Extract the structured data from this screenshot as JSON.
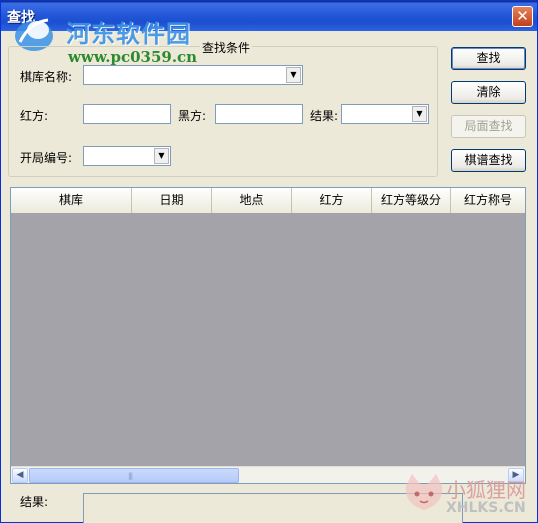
{
  "window": {
    "title": "查找",
    "close_glyph": "✕"
  },
  "watermark": {
    "brand": "河东软件园",
    "url": "www.pc0359.cn",
    "site2_cn": "小狐狸网",
    "site2_en": "XHLKS.CN"
  },
  "search": {
    "group_title": "查找条件",
    "game_name_label": "棋库名称:",
    "red_label": "红方:",
    "black_label": "黑方:",
    "result_label": "结果:",
    "opening_label": "开局编号:",
    "game_name_value": "",
    "red_value": "",
    "black_value": "",
    "result_value": "",
    "opening_value": ""
  },
  "buttons": {
    "find": "查找",
    "clear": "清除",
    "board_search": "局面查找",
    "pattern_search": "棋谱查找"
  },
  "table": {
    "columns": [
      "棋库",
      "日期",
      "地点",
      "红方",
      "红方等级分",
      "红方称号"
    ],
    "rows": []
  },
  "footer": {
    "result_label": "结果:",
    "result_value": ""
  },
  "icons": {
    "combo_arrow": "▼",
    "scroll_left": "◀",
    "scroll_right": "▶",
    "grip": "|||"
  }
}
